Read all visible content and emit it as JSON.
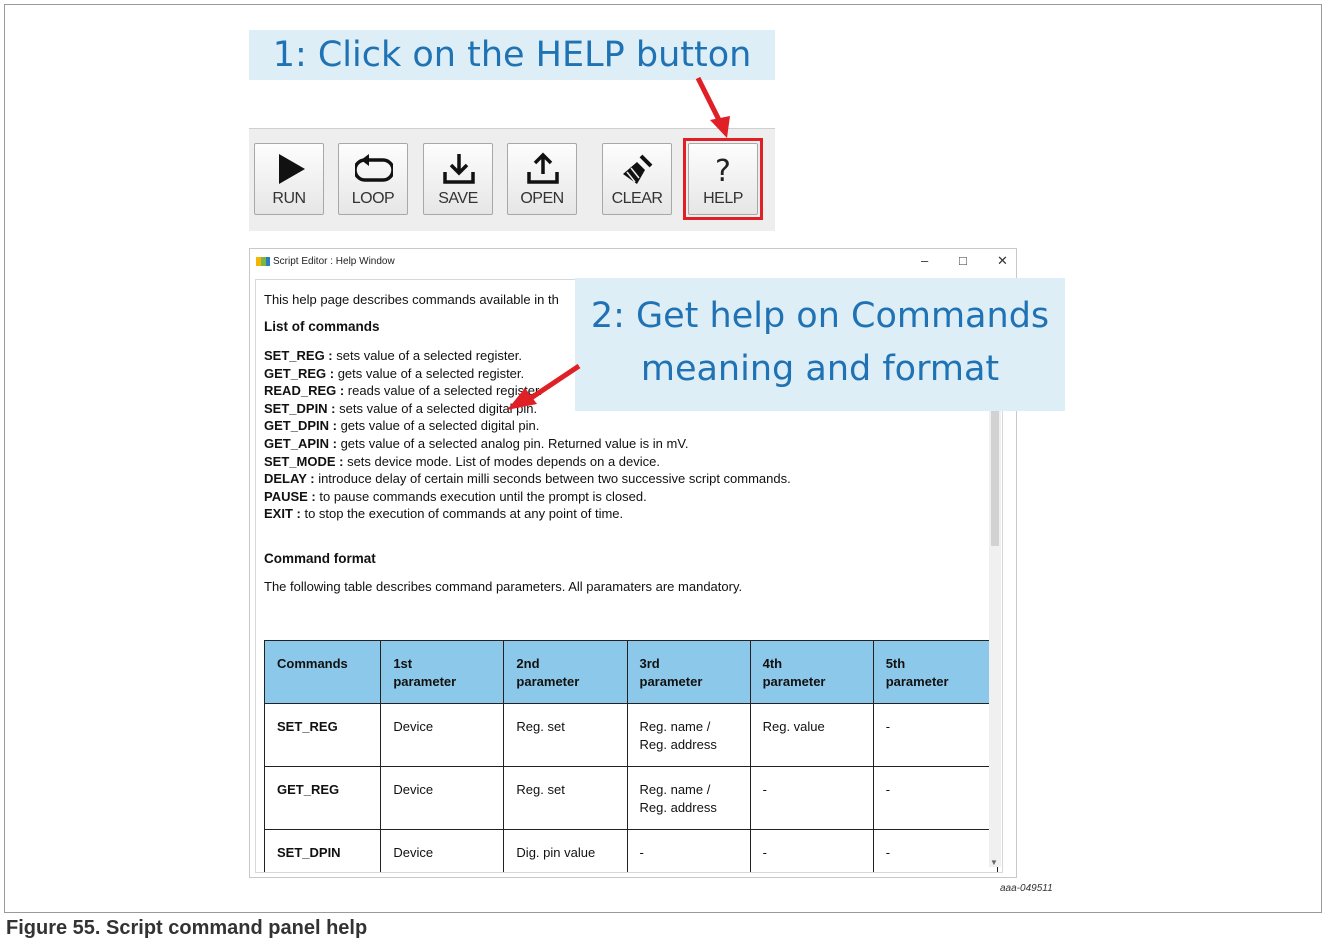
{
  "callouts": {
    "step1": "1: Click on the HELP button",
    "step2_line1": "2: Get help on Commands",
    "step2_line2": "meaning and format"
  },
  "toolbar": {
    "run": "RUN",
    "loop": "LOOP",
    "save": "SAVE",
    "open": "OPEN",
    "clear": "CLEAR",
    "help_symbol": "?",
    "help": "HELP"
  },
  "window": {
    "title": "Script Editor : Help Window",
    "controls": {
      "minimize": "–",
      "maximize": "□",
      "close": "✕"
    }
  },
  "help": {
    "intro": "This help page describes commands available in th",
    "list_heading": "List of commands",
    "commands": [
      {
        "name": "SET_REG :",
        "desc": " sets value of a selected register."
      },
      {
        "name": "GET_REG :",
        "desc": " gets value of a selected register."
      },
      {
        "name": "READ_REG :",
        "desc": " reads value of a selected register."
      },
      {
        "name": "SET_DPIN :",
        "desc": " sets value of a selected digital pin."
      },
      {
        "name": "GET_DPIN :",
        "desc": " gets value of a selected digital pin."
      },
      {
        "name": "GET_APIN :",
        "desc": " gets value of a selected analog pin. Returned value is in mV."
      },
      {
        "name": "SET_MODE :",
        "desc": " sets device mode. List of modes depends on a device."
      },
      {
        "name": "DELAY :",
        "desc": " introduce delay of certain milli seconds between two successive script commands."
      },
      {
        "name": "PAUSE :",
        "desc": " to pause commands execution until the prompt is closed."
      },
      {
        "name": "EXIT :",
        "desc": " to stop the execution of commands at any point of time."
      }
    ],
    "format_heading": "Command format",
    "format_desc": "The following table describes command parameters. All paramaters are mandatory.",
    "table": {
      "headers": [
        {
          "a": "Commands",
          "b": ""
        },
        {
          "a": "1st",
          "b": "parameter"
        },
        {
          "a": "2nd",
          "b": "parameter"
        },
        {
          "a": "3rd",
          "b": "parameter"
        },
        {
          "a": "4th",
          "b": "parameter"
        },
        {
          "a": "5th",
          "b": "parameter"
        }
      ],
      "rows": [
        [
          {
            "a": "SET_REG",
            "b": ""
          },
          {
            "a": "Device",
            "b": ""
          },
          {
            "a": "Reg. set",
            "b": ""
          },
          {
            "a": "Reg. name /",
            "b": "Reg. address"
          },
          {
            "a": "Reg. value",
            "b": ""
          },
          {
            "a": "-",
            "b": ""
          }
        ],
        [
          {
            "a": "GET_REG",
            "b": ""
          },
          {
            "a": "Device",
            "b": ""
          },
          {
            "a": "Reg. set",
            "b": ""
          },
          {
            "a": "Reg. name /",
            "b": "Reg. address"
          },
          {
            "a": "-",
            "b": ""
          },
          {
            "a": "-",
            "b": ""
          }
        ],
        [
          {
            "a": "SET_DPIN",
            "b": ""
          },
          {
            "a": "Device",
            "b": ""
          },
          {
            "a": "Dig. pin value",
            "b": ""
          },
          {
            "a": "-",
            "b": ""
          },
          {
            "a": "-",
            "b": ""
          },
          {
            "a": "-",
            "b": ""
          }
        ]
      ]
    }
  },
  "figure": {
    "id": "aaa-049511",
    "caption": "Figure 55.  Script command panel help"
  },
  "colors": {
    "callout_bg": "#ddeef6",
    "callout_text": "#1f72b3",
    "highlight_red": "#e01f26",
    "table_header_bg": "#8cc8ea"
  }
}
